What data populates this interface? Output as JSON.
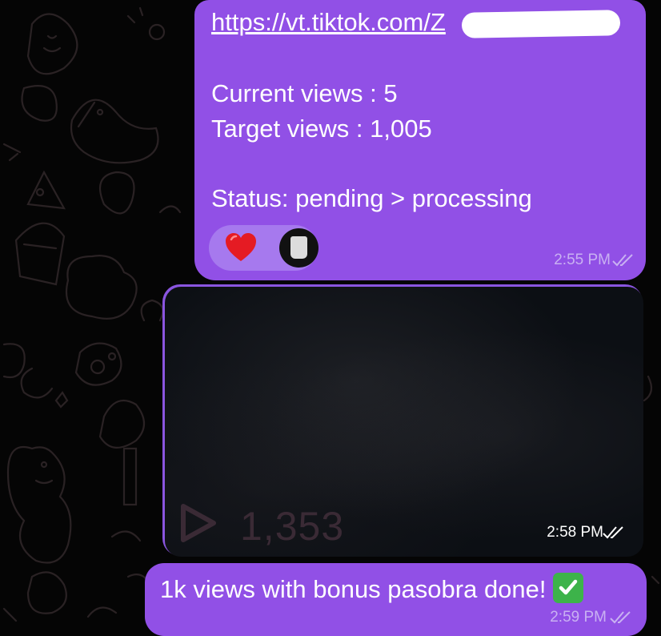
{
  "chat": {
    "messages": [
      {
        "link": "https://vt.tiktok.com/Z",
        "lines": [
          "Current views : 5",
          "Target views : 1,005",
          "Status: pending > processing"
        ],
        "reactions": [
          "heart-emoji",
          "user-avatar"
        ],
        "time": "2:55 PM",
        "status": "read"
      },
      {
        "video": {
          "view_count": "1,353"
        },
        "time": "2:58 PM",
        "status": "read"
      },
      {
        "text": "1k views with bonus pasobra done!",
        "emoji": "check-mark-button",
        "time": "2:59 PM",
        "status": "read"
      }
    ]
  },
  "colors": {
    "bubble": "#9150e6",
    "reaction_pill": "#a679ee",
    "timestamp": "#c9b1f2",
    "heart": "#e51b23",
    "check": "#3db34a",
    "background": "#050505"
  }
}
